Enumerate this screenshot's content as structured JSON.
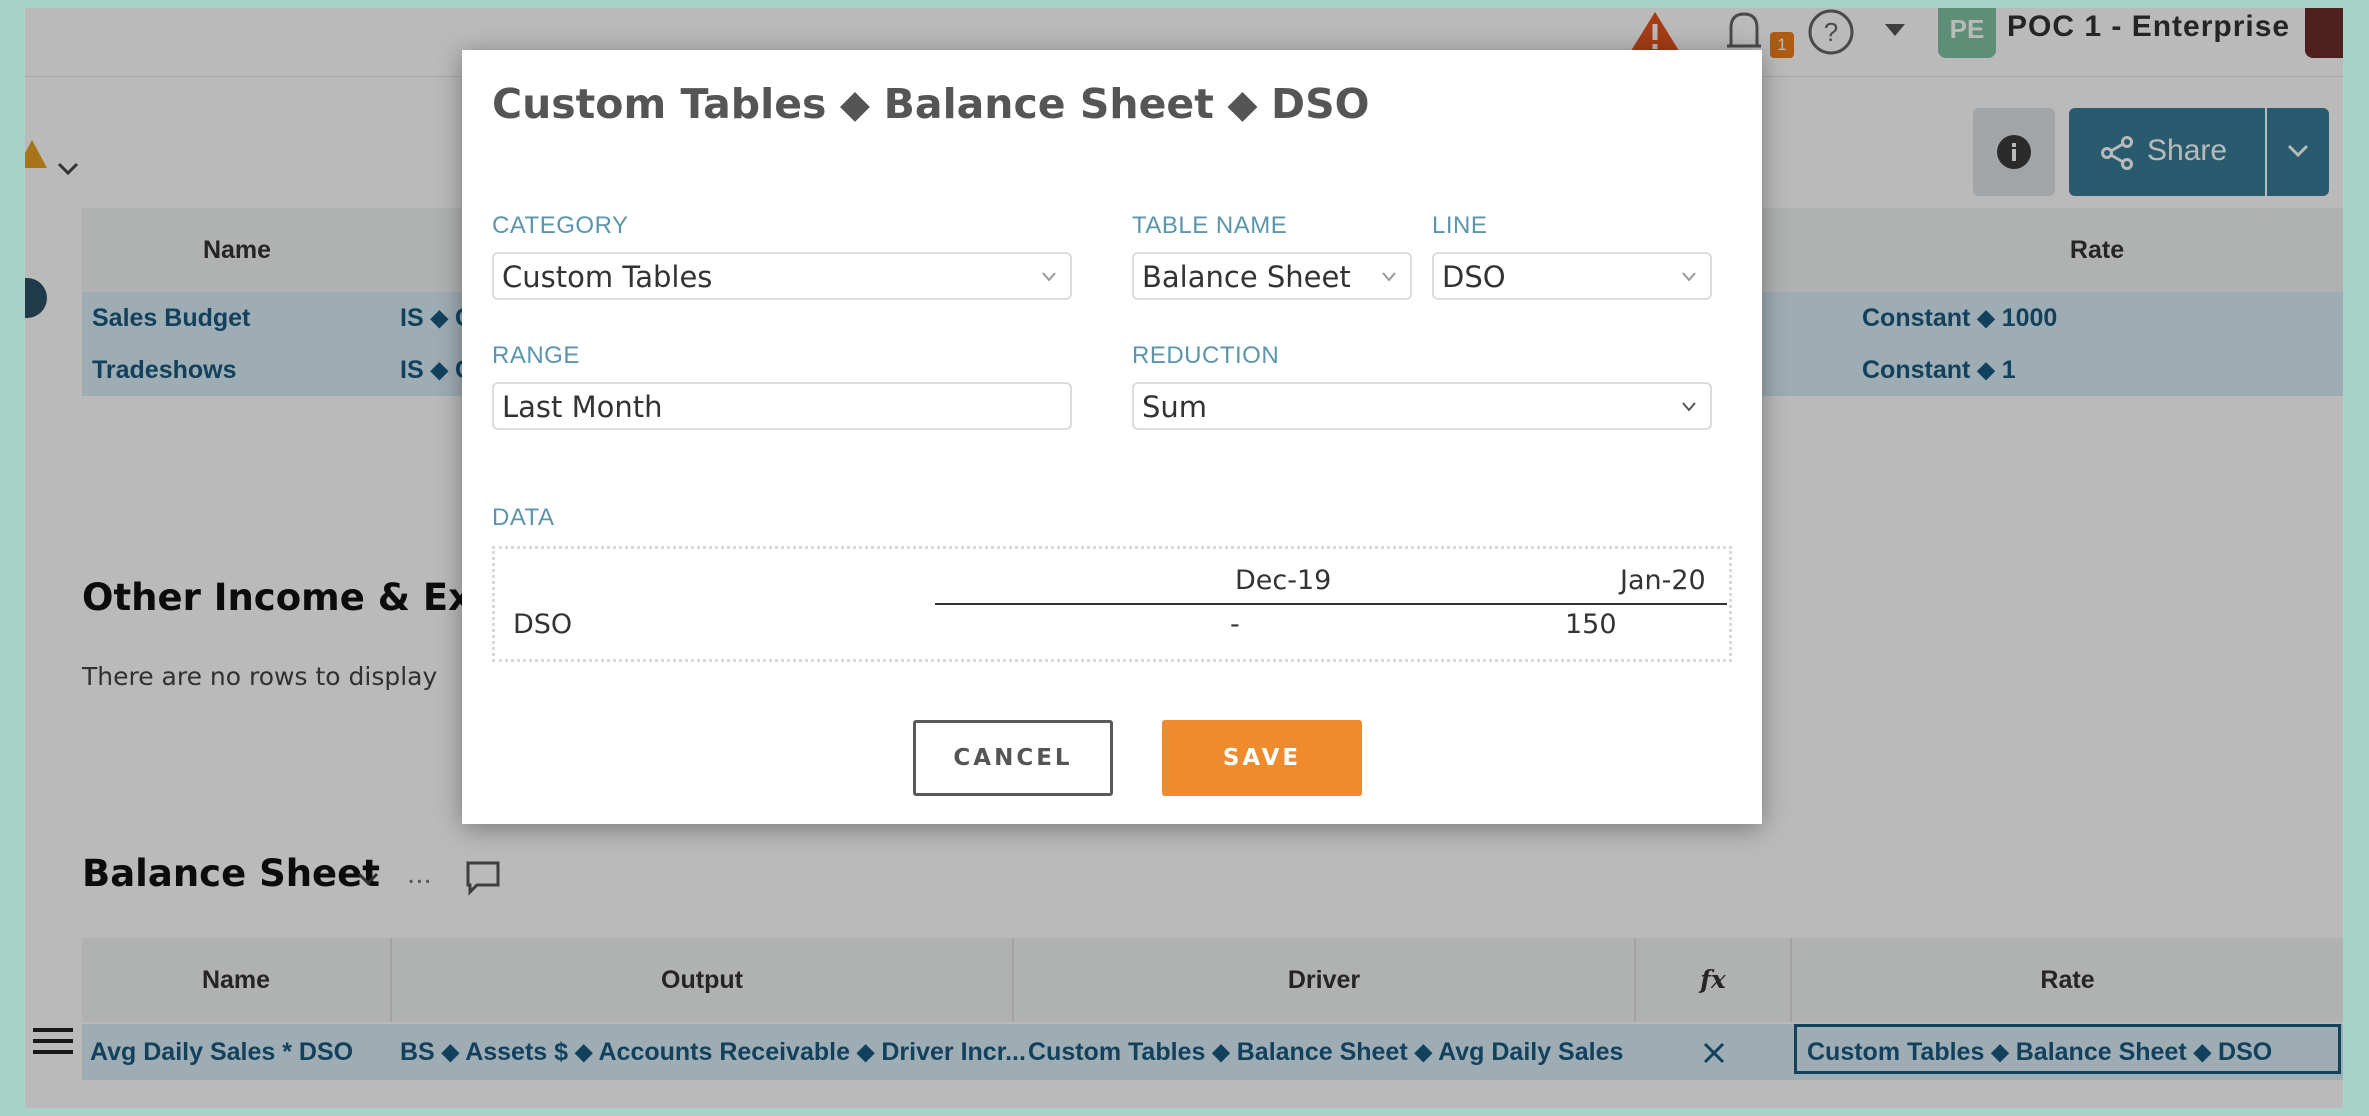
{
  "topbar": {
    "notification_count": "1",
    "org_initials": "PE",
    "org_name": "POC 1 - Enterprise"
  },
  "toolbar": {
    "share_label": "Share"
  },
  "driver_table_top": {
    "columns": [
      "Name",
      "Rate"
    ],
    "rows": [
      {
        "name": "Sales Budget",
        "output_prefix": "IS ⬥ C",
        "rate": "Constant ⬥ 1000"
      },
      {
        "name": "Tradeshows",
        "output_prefix": "IS ⬥ C",
        "rate": "Constant ⬥ 1"
      }
    ]
  },
  "other_income": {
    "title": "Other Income & Expe",
    "empty_text": "There are no rows to display"
  },
  "balance_sheet": {
    "title": "Balance Sheet",
    "dots": "...",
    "columns": [
      "Name",
      "Output",
      "Driver",
      "fx",
      "Rate"
    ],
    "rows": [
      {
        "name": "Avg Daily Sales * DSO",
        "output": "BS ⬥ Assets $ ⬥ Accounts Receivable ⬥ Driver Incr...",
        "driver": "Custom Tables ⬥ Balance Sheet ⬥ Avg Daily Sales",
        "rate": "Custom Tables ⬥ Balance Sheet ⬥ DSO"
      }
    ]
  },
  "modal": {
    "title": "Custom Tables ⬥ Balance Sheet ⬥ DSO",
    "category": {
      "label": "CATEGORY",
      "value": "Custom Tables"
    },
    "table_name": {
      "label": "TABLE NAME",
      "value": "Balance Sheet"
    },
    "line": {
      "label": "LINE",
      "value": "DSO"
    },
    "range": {
      "label": "RANGE",
      "value": "Last Month"
    },
    "reduction": {
      "label": "REDUCTION",
      "value": "Sum"
    },
    "data": {
      "label": "DATA",
      "columns": [
        "Dec-19",
        "Jan-20"
      ],
      "row_label": "DSO",
      "values": [
        "-",
        "150"
      ]
    },
    "cancel_label": "CANCEL",
    "save_label": "SAVE"
  },
  "colors": {
    "accent_orange": "#ef8a2d",
    "share_blue": "#367d96",
    "label_blue": "#5a95ad",
    "link_blue": "#1a5a80",
    "frame_green": "#a9d3c8"
  }
}
